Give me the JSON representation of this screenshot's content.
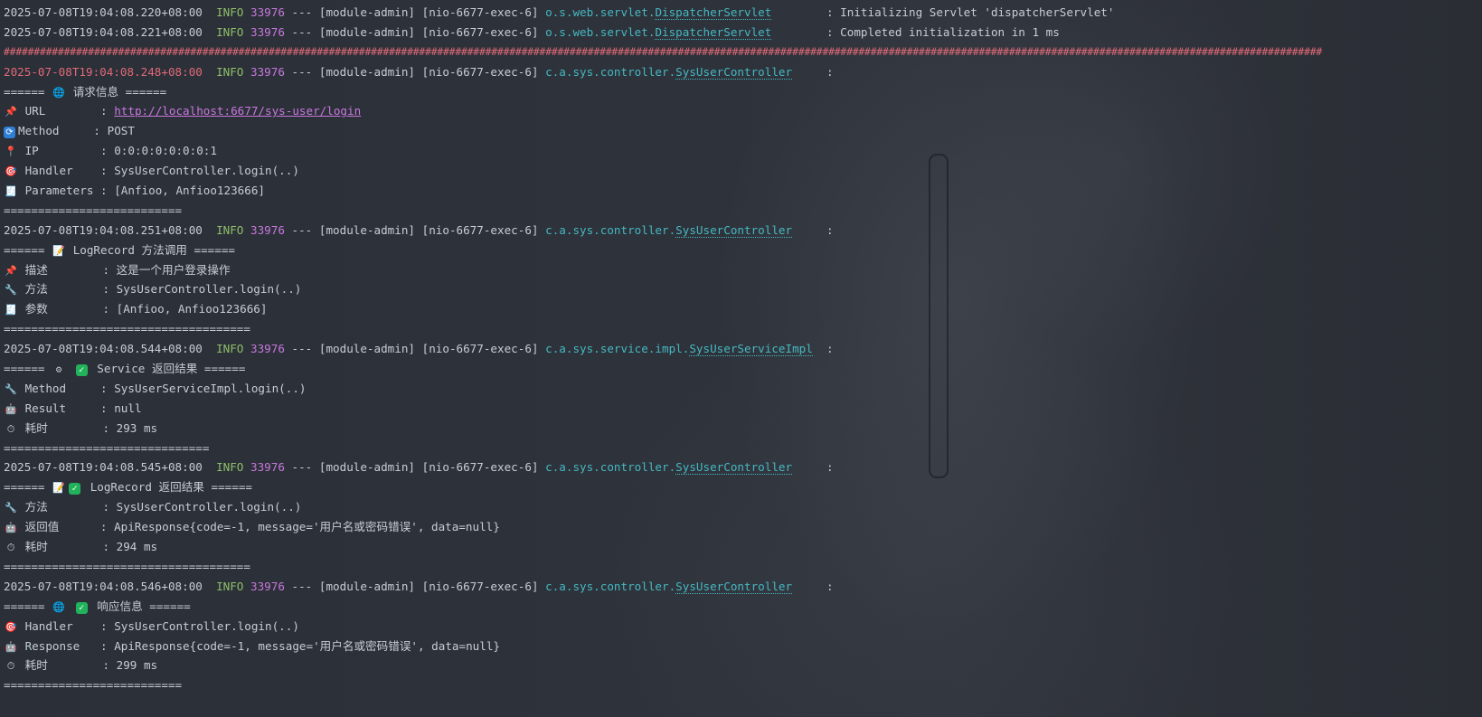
{
  "log": {
    "head1": {
      "ts": "2025-07-08T19:04:08.220+08:00",
      "level": "INFO",
      "pid": "33976",
      "sep": "---",
      "module": "[module-admin]",
      "thread": "[nio-6677-exec-6]",
      "pkg": "o.s.web.servlet.",
      "cls": "DispatcherServlet",
      "msg": "Initializing Servlet 'dispatcherServlet'"
    },
    "head2": {
      "ts": "2025-07-08T19:04:08.221+08:00",
      "level": "INFO",
      "pid": "33976",
      "sep": "---",
      "module": "[module-admin]",
      "thread": "[nio-6677-exec-6]",
      "pkg": "o.s.web.servlet.",
      "cls": "DispatcherServlet",
      "msg": "Completed initialization in 1 ms"
    },
    "hashline": "###########################################################################################################################################################################################################################",
    "e1": {
      "ts": "2025-07-08T19:04:08.248+08:00",
      "level": "INFO",
      "pid": "33976",
      "sep": "---",
      "module": "[module-admin]",
      "thread": "[nio-6677-exec-6]",
      "pkg": "c.a.sys.controller.",
      "cls": "SysUserController",
      "colon": ":"
    },
    "b1": {
      "title_pre": "======",
      "title": "请求信息",
      "title_post": "======",
      "url_key": "URL",
      "url_sep": ":",
      "url_val": "http://localhost:6677/sys-user/login",
      "method_key": "Method",
      "method_sep": ":",
      "method_val": "POST",
      "ip_key": "IP",
      "ip_sep": ":",
      "ip_val": "0:0:0:0:0:0:0:1",
      "handler_key": "Handler",
      "handler_sep": ":",
      "handler_val": "SysUserController.login(..)",
      "params_key": "Parameters",
      "params_sep": ":",
      "params_val": "[Anfioo, Anfioo123666]",
      "rule": "=========================="
    },
    "e2": {
      "ts": "2025-07-08T19:04:08.251+08:00",
      "level": "INFO",
      "pid": "33976",
      "sep": "---",
      "module": "[module-admin]",
      "thread": "[nio-6677-exec-6]",
      "pkg": "c.a.sys.controller.",
      "cls": "SysUserController",
      "colon": ":"
    },
    "b2": {
      "title_pre": "======",
      "title": "LogRecord 方法调用",
      "title_post": "======",
      "desc_key": "描述",
      "desc_sep": ":",
      "desc_val": "这是一个用户登录操作",
      "method_key": "方法",
      "method_sep": ":",
      "method_val": "SysUserController.login(..)",
      "params_key": "参数",
      "params_sep": ":",
      "params_val": "[Anfioo, Anfioo123666]",
      "rule": "===================================="
    },
    "e3": {
      "ts": "2025-07-08T19:04:08.544+08:00",
      "level": "INFO",
      "pid": "33976",
      "sep": "---",
      "module": "[module-admin]",
      "thread": "[nio-6677-exec-6]",
      "pkg": "c.a.sys.service.impl.",
      "cls": "SysUserServiceImpl",
      "colon": ":"
    },
    "b3": {
      "title_pre": "======",
      "title": "Service 返回结果",
      "title_post": "======",
      "method_key": "Method",
      "method_sep": ":",
      "method_val": "SysUserServiceImpl.login(..)",
      "result_key": "Result",
      "result_sep": ":",
      "result_val": "null",
      "time_key": "耗时",
      "time_sep": ":",
      "time_val": "293 ms",
      "rule": "=============================="
    },
    "e4": {
      "ts": "2025-07-08T19:04:08.545+08:00",
      "level": "INFO",
      "pid": "33976",
      "sep": "---",
      "module": "[module-admin]",
      "thread": "[nio-6677-exec-6]",
      "pkg": "c.a.sys.controller.",
      "cls": "SysUserController",
      "colon": ":"
    },
    "b4": {
      "title_pre": "======",
      "title": "LogRecord 返回结果",
      "title_post": "======",
      "method_key": "方法",
      "method_sep": ":",
      "method_val": "SysUserController.login(..)",
      "ret_key": "返回值",
      "ret_sep": ":",
      "ret_val": "ApiResponse{code=-1, message='用户名或密码错误', data=null}",
      "time_key": "耗时",
      "time_sep": ":",
      "time_val": "294 ms",
      "rule": "===================================="
    },
    "e5": {
      "ts": "2025-07-08T19:04:08.546+08:00",
      "level": "INFO",
      "pid": "33976",
      "sep": "---",
      "module": "[module-admin]",
      "thread": "[nio-6677-exec-6]",
      "pkg": "c.a.sys.controller.",
      "cls": "SysUserController",
      "colon": ":"
    },
    "b5": {
      "title_pre": "======",
      "title": "响应信息",
      "title_post": "======",
      "handler_key": "Handler",
      "handler_sep": ":",
      "handler_val": "SysUserController.login(..)",
      "resp_key": "Response",
      "resp_sep": ":",
      "resp_val": "ApiResponse{code=-1, message='用户名或密码错误', data=null}",
      "time_key": "耗时",
      "time_sep": ":",
      "time_val": "299 ms",
      "rule": "=========================="
    }
  },
  "icons": {
    "pin": "pushpin-icon",
    "refresh": "refresh-icon",
    "place": "location-icon",
    "target": "target-icon",
    "receipt": "receipt-icon",
    "memo": "memo-icon",
    "wrench": "wrench-icon",
    "gear": "gear-icon",
    "check": "check-icon",
    "robot": "robot-icon",
    "timer": "stopwatch-icon",
    "globe": "globe-icon"
  }
}
